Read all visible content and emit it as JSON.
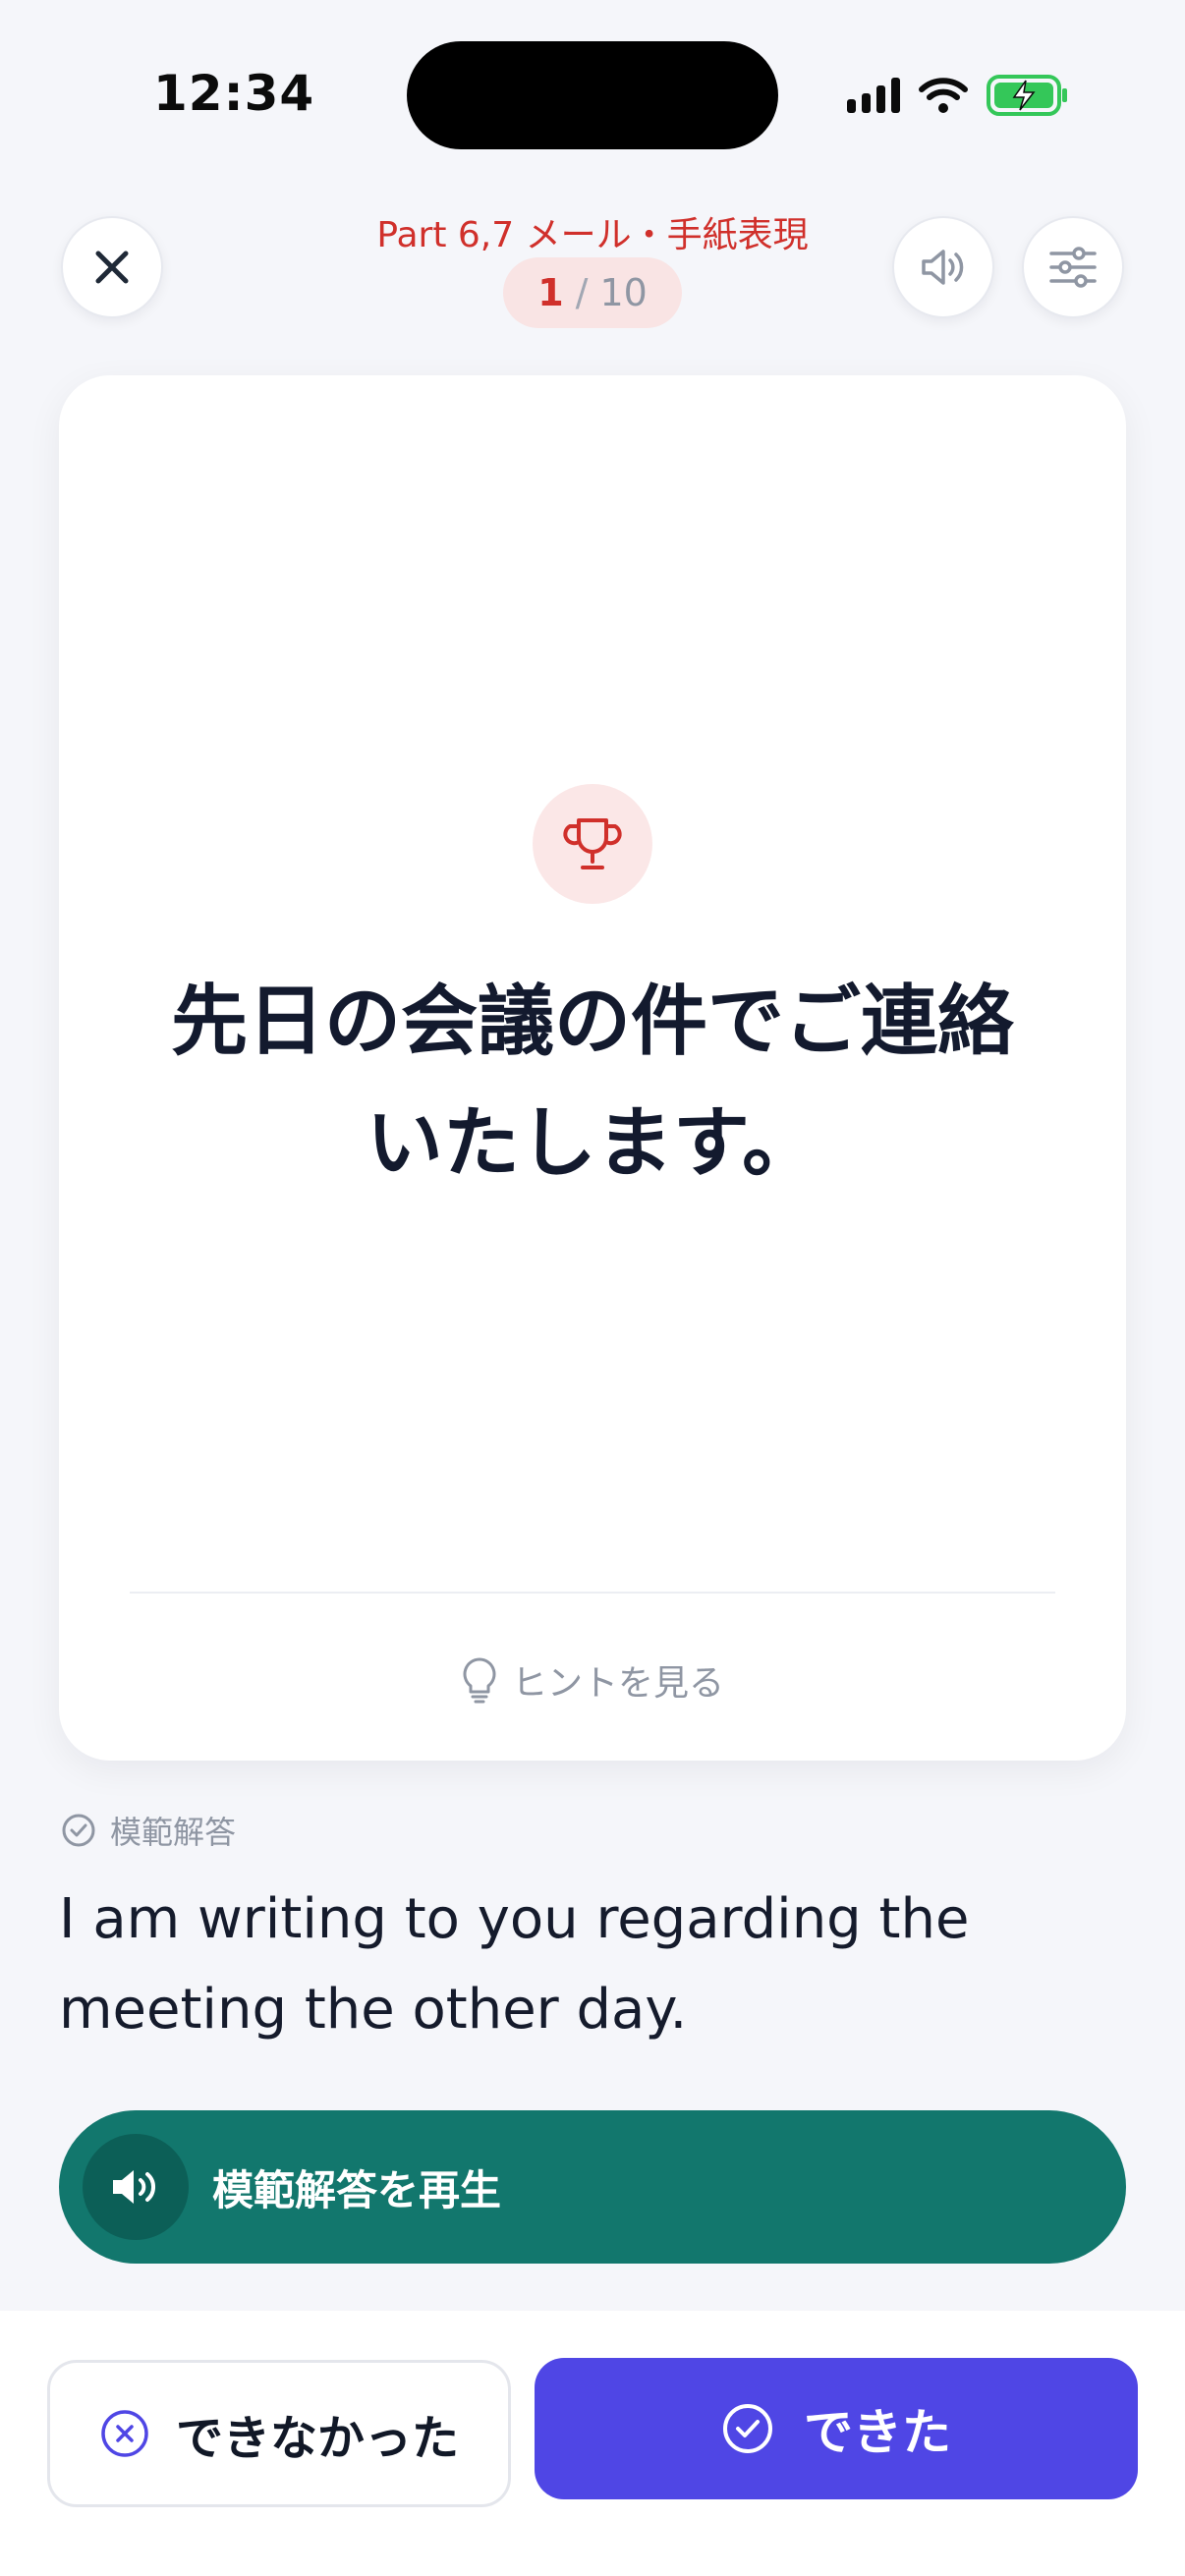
{
  "status_bar": {
    "time": "12:34"
  },
  "header": {
    "category": "Part 6,7 メール・手紙表現",
    "progress": {
      "current": "1",
      "separator": "/",
      "total": "10"
    }
  },
  "card": {
    "prompt_line1": "先日の会議の件でご連絡",
    "prompt_line2": "いたします。",
    "hint_label": "ヒントを見る"
  },
  "answer": {
    "label": "模範解答",
    "text": "I am writing to you regarding the meeting the other day.",
    "play_label": "模範解答を再生"
  },
  "actions": {
    "fail_label": "できなかった",
    "ok_label": "できた"
  },
  "colors": {
    "accent_red": "#d0302b",
    "play_green": "#12776d",
    "primary_indigo": "#4f46e5",
    "battery_green": "#34c759"
  },
  "icons": [
    "close-icon",
    "speaker-icon",
    "sliders-icon",
    "trophy-icon",
    "lightbulb-icon",
    "check-circle-icon",
    "x-circle-icon"
  ]
}
